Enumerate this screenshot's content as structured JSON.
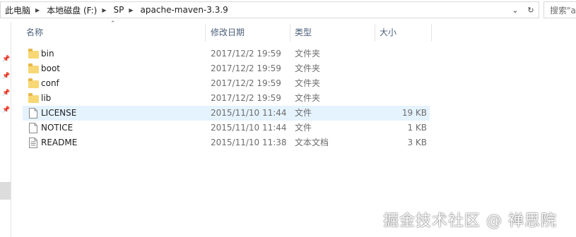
{
  "address": {
    "crumbs": [
      "此电脑",
      "本地磁盘 (F:)",
      "SP",
      "apache-maven-3.3.9"
    ],
    "dropdown_icon": "chevron-down-icon",
    "refresh_icon": "refresh-icon"
  },
  "search": {
    "placeholder": "搜索\"a"
  },
  "columns": {
    "name": "名称",
    "date": "修改日期",
    "type": "类型",
    "size": "大小"
  },
  "files": [
    {
      "name": "bin",
      "date": "2017/12/2 19:59",
      "type": "文件夹",
      "size": "",
      "kind": "folder"
    },
    {
      "name": "boot",
      "date": "2017/12/2 19:59",
      "type": "文件夹",
      "size": "",
      "kind": "folder"
    },
    {
      "name": "conf",
      "date": "2017/12/2 19:59",
      "type": "文件夹",
      "size": "",
      "kind": "folder"
    },
    {
      "name": "lib",
      "date": "2017/12/2 19:59",
      "type": "文件夹",
      "size": "",
      "kind": "folder"
    },
    {
      "name": "LICENSE",
      "date": "2015/11/10 11:44",
      "type": "文件",
      "size": "19 KB",
      "kind": "file"
    },
    {
      "name": "NOTICE",
      "date": "2015/11/10 11:44",
      "type": "文件",
      "size": "1 KB",
      "kind": "file"
    },
    {
      "name": "README",
      "date": "2015/11/10 11:38",
      "type": "文本文档",
      "size": "3 KB",
      "kind": "text"
    }
  ],
  "highlighted_row": "LICENSE",
  "watermark": "掘金技术社区 @ 禅思院",
  "colors": {
    "header_text": "#4c607a",
    "hover_row": "#e5f3ff",
    "folder": "#f8d775"
  }
}
